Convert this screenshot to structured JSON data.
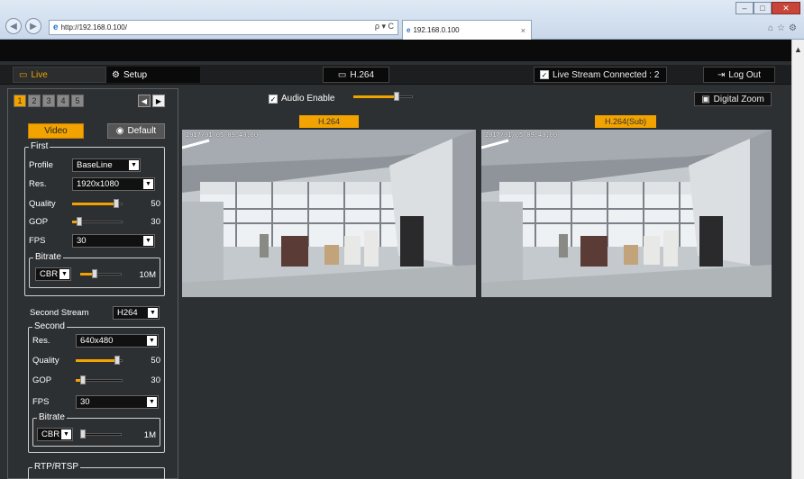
{
  "browser": {
    "url": "http://192.168.0.100/",
    "search_symbols": "ρ ▾ C",
    "tab_title": "192.168.0.100",
    "tab_close": "×"
  },
  "menu": {
    "live": "Live",
    "setup": "Setup",
    "codec": "H.264",
    "connection": "Live Stream Connected : 2",
    "logout": "Log Out"
  },
  "channels": [
    "1",
    "2",
    "3",
    "4",
    "5"
  ],
  "panel": {
    "video_btn": "Video",
    "default_btn": "Default",
    "first": {
      "legend": "First",
      "profile_label": "Profile",
      "profile": "BaseLine",
      "res_label": "Res.",
      "res": "1920x1080",
      "quality_label": "Quality",
      "quality": "50",
      "gop_label": "GOP",
      "gop": "30",
      "fps_label": "FPS",
      "fps": "30",
      "bitrate_legend": "Bitrate",
      "bitrate_mode": "CBR",
      "bitrate": "10M"
    },
    "second_stream_label": "Second Stream",
    "second_stream_codec": "H264",
    "second": {
      "legend": "Second",
      "res_label": "Res.",
      "res": "640x480",
      "quality_label": "Quality",
      "quality": "50",
      "gop_label": "GOP",
      "gop": "30",
      "fps_label": "FPS",
      "fps": "30",
      "bitrate_legend": "Bitrate",
      "bitrate_mode": "CBR",
      "bitrate": "1M"
    },
    "rtp_legend": "RTP/RTSP"
  },
  "viewer": {
    "audio_enable": "Audio Enable",
    "audio_level": 0.72,
    "digital_zoom": "Digital Zoom",
    "stream1_label": "H.264",
    "stream2_label": "H.264(Sub)",
    "osd1": "2017/01/05 09:40:00",
    "osd2": "2017/01/05 09:40:00"
  },
  "slider_levels": {
    "first_quality": 0.88,
    "first_gop": 0.15,
    "first_bitrate": 0.35,
    "second_quality": 0.88,
    "second_gop": 0.15,
    "second_bitrate": 0.02
  },
  "colors": {
    "accent": "#f2a300",
    "panel": "#2d3032",
    "bar": "#0a0a0a"
  }
}
